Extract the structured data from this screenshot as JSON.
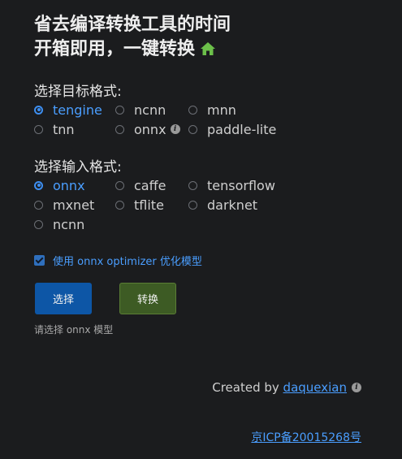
{
  "headline": {
    "line1": "省去编译转换工具的时间",
    "line2": "开箱即用，一键转换"
  },
  "target": {
    "title": "选择目标格式:",
    "options": [
      "tengine",
      "ncnn",
      "mnn",
      "tnn",
      "onnx",
      "paddle-lite"
    ],
    "selected": "tengine"
  },
  "input": {
    "title": "选择输入格式:",
    "options": [
      "onnx",
      "caffe",
      "tensorflow",
      "mxnet",
      "tflite",
      "darknet",
      "ncnn"
    ],
    "selected": "onnx"
  },
  "optimizer": {
    "label": "使用 onnx optimizer 优化模型",
    "checked": true
  },
  "buttons": {
    "select": "选择",
    "convert": "转换"
  },
  "hint": "请选择 onnx 模型",
  "footer": {
    "created_by": "Created by",
    "author": "daquexian",
    "icp": "京ICP备20015268号"
  },
  "colors": {
    "background": "#1b1c1e",
    "accent": "#4a9eff",
    "select_button": "#0d56a6",
    "convert_button": "#3d5b24",
    "home_icon": "#6cc04a"
  }
}
